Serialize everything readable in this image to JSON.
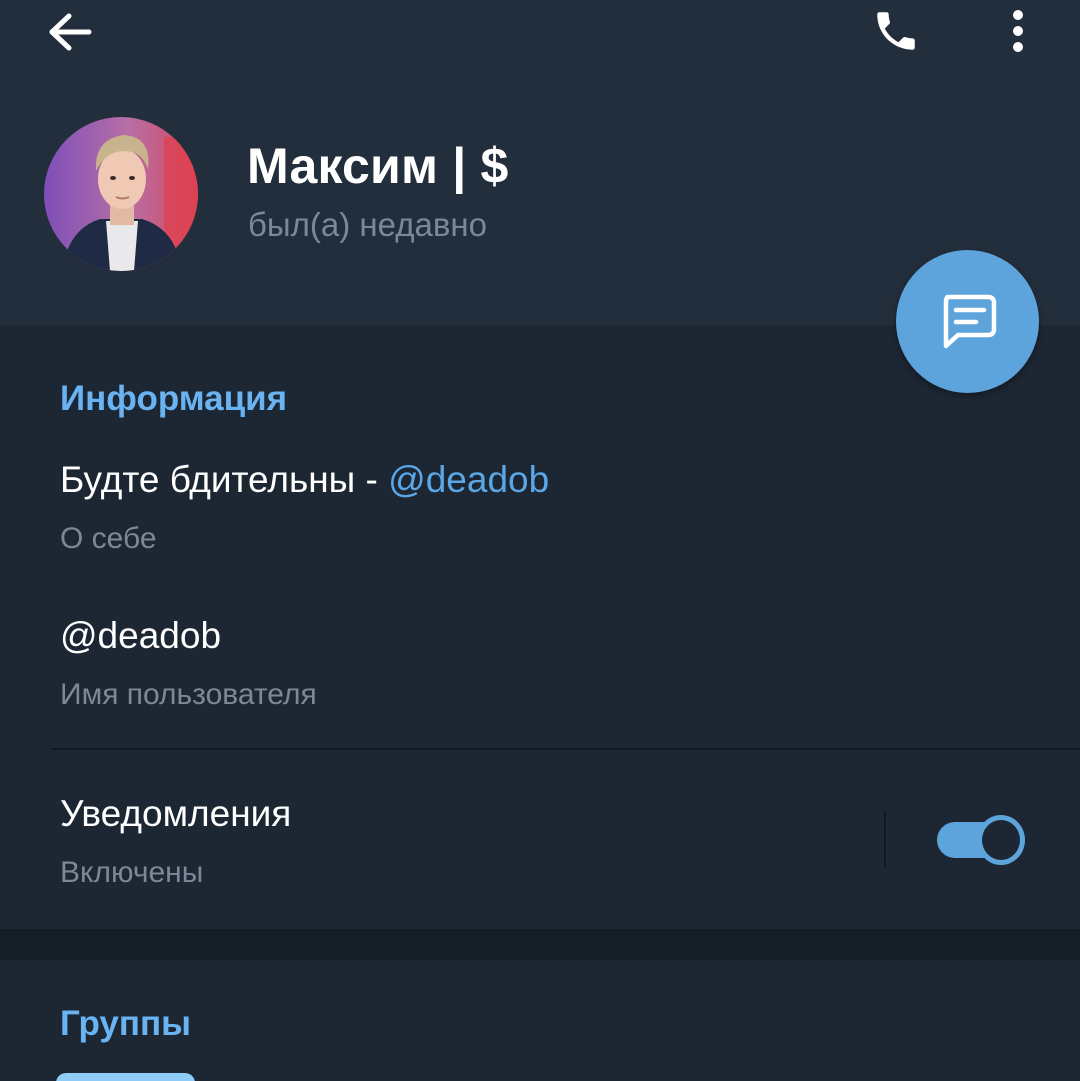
{
  "header": {
    "back_icon": "arrow-left-icon",
    "call_icon": "phone-icon",
    "menu_icon": "more-vertical-icon"
  },
  "profile": {
    "name": "Максим | $",
    "status": "был(а) недавно"
  },
  "fab": {
    "icon": "message-icon"
  },
  "info": {
    "section_title": "Информация",
    "bio_text": "Будте бдительны - ",
    "bio_mention": "@deadob",
    "bio_label": "О себе",
    "username": "@deadob",
    "username_label": "Имя пользователя",
    "notifications_title": "Уведомления",
    "notifications_status": "Включены",
    "notifications_enabled": true
  },
  "groups": {
    "section_title": "Группы"
  },
  "colors": {
    "header_bg": "#232e3c",
    "body_bg": "#1d2733",
    "accent": "#5ea4dc",
    "section_title": "#6ab3f3",
    "secondary_text": "#7b8897"
  }
}
